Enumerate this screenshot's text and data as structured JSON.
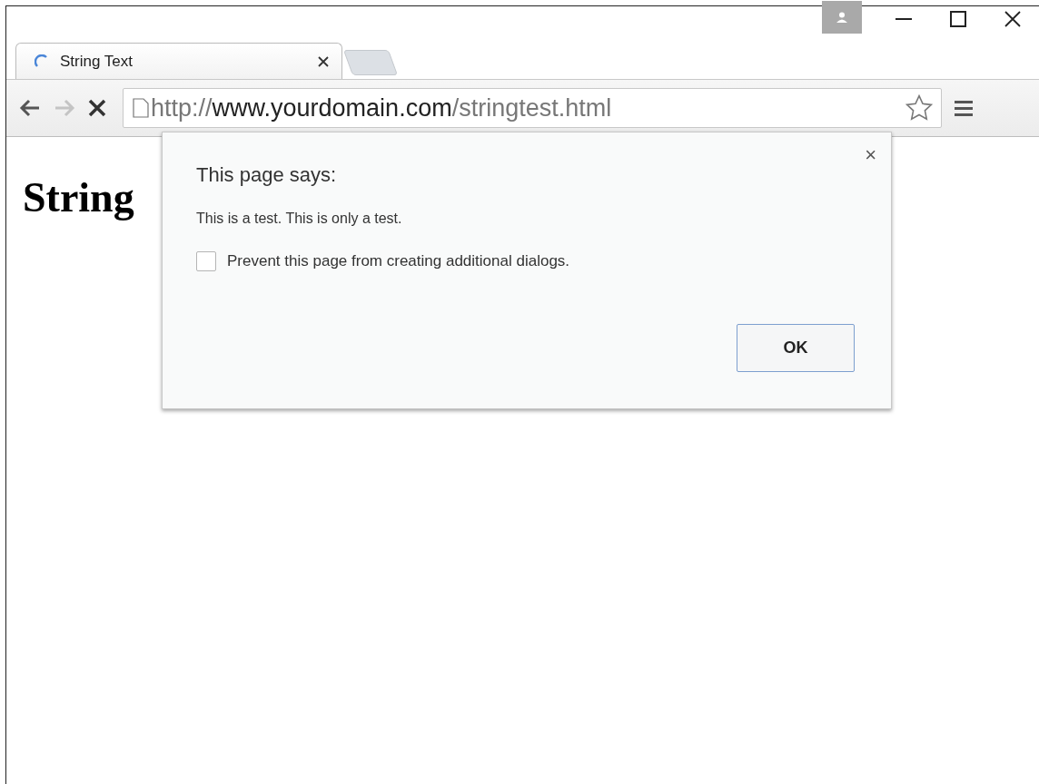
{
  "tabs": [
    {
      "title": "String Text",
      "loading": true,
      "selected": true
    }
  ],
  "toolbar": {
    "forward_disabled": true,
    "address": {
      "scheme": "http://",
      "host": "www.yourdomain.com",
      "path": "/stringtest.html"
    }
  },
  "page": {
    "heading": "String"
  },
  "dialog": {
    "title": "This page says:",
    "message": "This is a test. This is only a test.",
    "checkbox": {
      "label": "Prevent this page from creating additional dialogs.",
      "checked": false
    },
    "close": "×",
    "buttons": [
      "OK"
    ]
  }
}
